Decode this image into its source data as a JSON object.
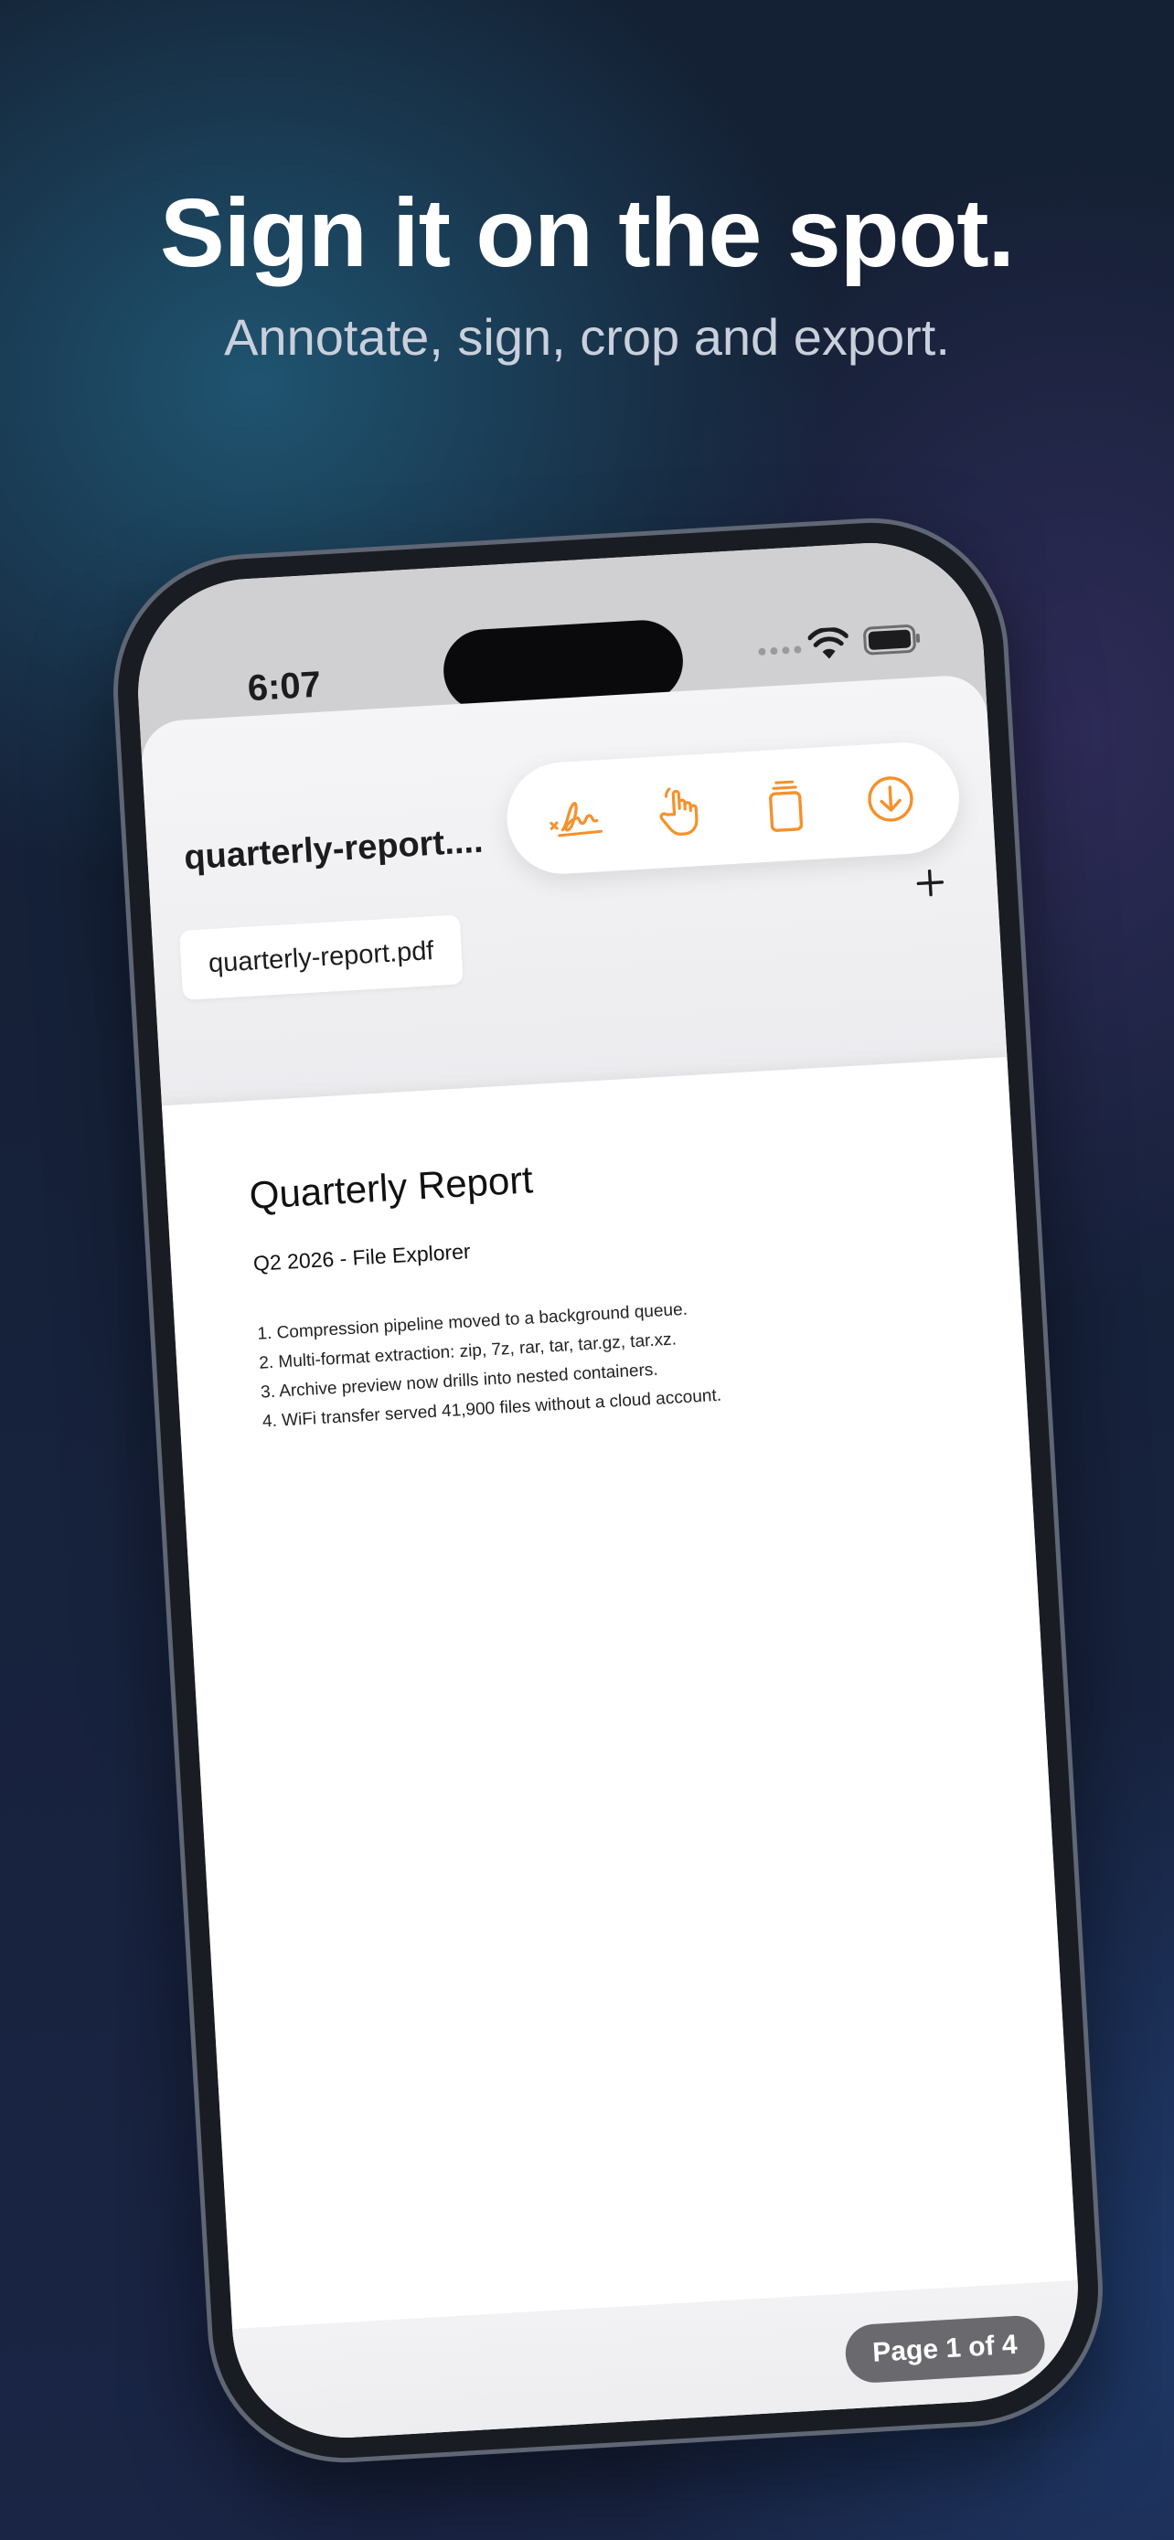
{
  "hero": {
    "title": "Sign it on the spot.",
    "subtitle": "Annotate, sign, crop and export."
  },
  "status_bar": {
    "time": "6:07"
  },
  "nav": {
    "title": "quarterly-report....",
    "toolbar": [
      "signature-icon",
      "hand-pointer-icon",
      "stack-copy-icon",
      "download-circle-icon"
    ],
    "accent_color": "#f5912b",
    "add_icon": "plus-icon"
  },
  "file_chip": {
    "label": "quarterly-report.pdf"
  },
  "document": {
    "title": "Quarterly Report",
    "subtitle": "Q2 2026 - File Explorer",
    "items": [
      "1. Compression pipeline moved to a background queue.",
      "2. Multi-format extraction: zip, 7z, rar, tar, tar.gz, tar.xz.",
      "3. Archive preview now drills into nested containers.",
      "4. WiFi transfer served 41,900 files without a cloud account."
    ]
  },
  "pager": {
    "label": "Page 1 of 4"
  }
}
